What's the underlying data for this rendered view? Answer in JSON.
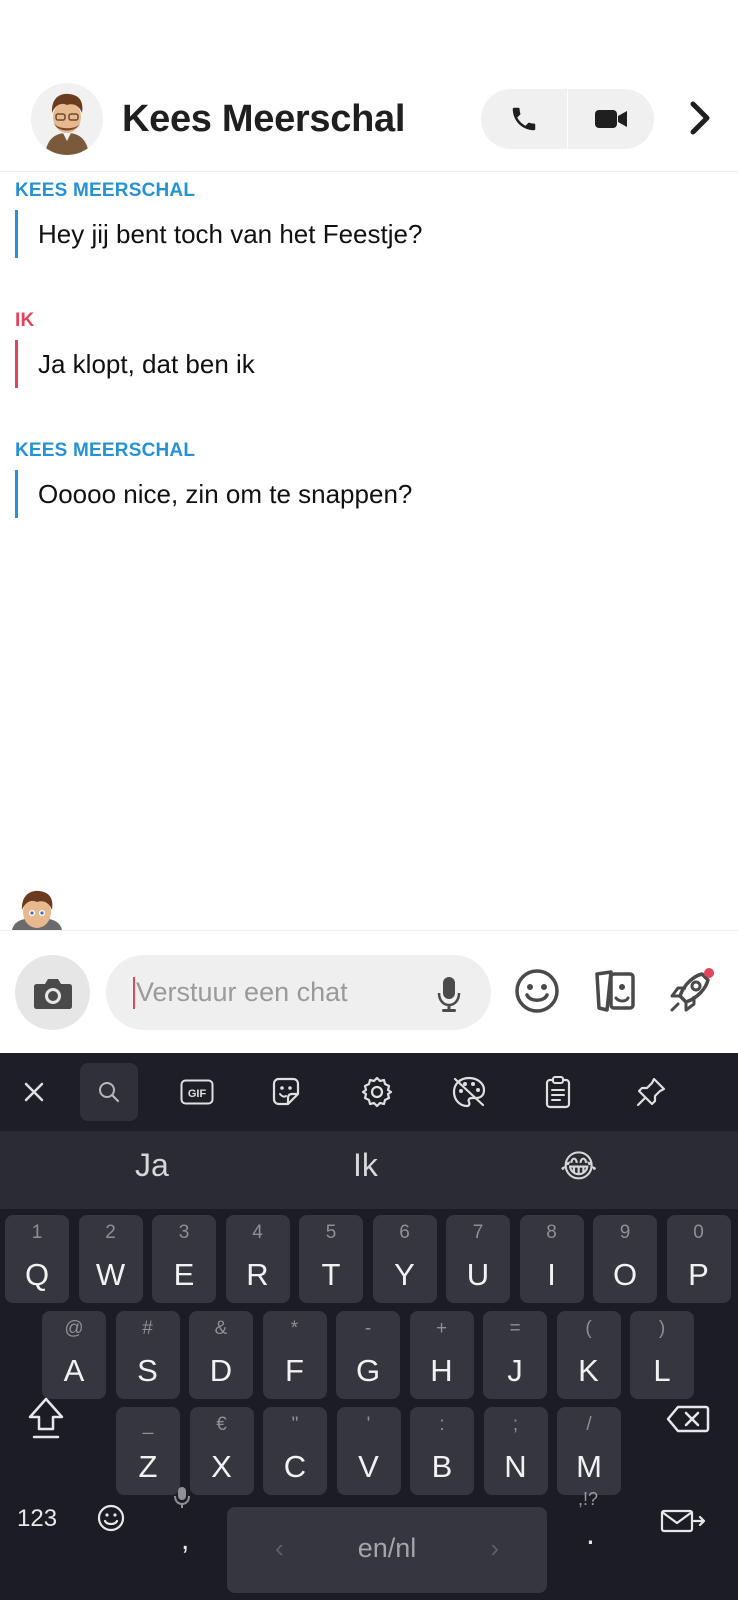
{
  "header": {
    "contact_name": "Kees Meerschal"
  },
  "messages": [
    {
      "sender": "KEES MEERSCHAL",
      "text": "Hey jij bent toch van het Feestje?"
    },
    {
      "sender": "IK",
      "text": "Ja klopt, dat ben ik"
    },
    {
      "sender": "KEES MEERSCHAL",
      "text": "Ooooo nice, zin om te snappen?"
    }
  ],
  "composer": {
    "placeholder": "Verstuur een chat"
  },
  "colors": {
    "contact": "#2592d4",
    "me": "#e2445c",
    "notification_dot": "#e2445c",
    "keyboard_bg": "#1c1c24",
    "key_bg": "#35363e"
  },
  "keyboard": {
    "toolbar": [
      "close-icon",
      "search-icon",
      "gif-icon",
      "sticker-icon",
      "settings-icon",
      "palette-icon",
      "clipboard-icon",
      "pin-icon"
    ],
    "gif_label": "GIF",
    "suggestions": [
      "Ja",
      "Ik",
      "😂"
    ],
    "row1": [
      {
        "main": "Q",
        "sub": "1"
      },
      {
        "main": "W",
        "sub": "2"
      },
      {
        "main": "E",
        "sub": "3"
      },
      {
        "main": "R",
        "sub": "4"
      },
      {
        "main": "T",
        "sub": "5"
      },
      {
        "main": "Y",
        "sub": "6"
      },
      {
        "main": "U",
        "sub": "7"
      },
      {
        "main": "I",
        "sub": "8"
      },
      {
        "main": "O",
        "sub": "9"
      },
      {
        "main": "P",
        "sub": "0"
      }
    ],
    "row2": [
      {
        "main": "A",
        "sub": "@"
      },
      {
        "main": "S",
        "sub": "#"
      },
      {
        "main": "D",
        "sub": "&"
      },
      {
        "main": "F",
        "sub": "*"
      },
      {
        "main": "G",
        "sub": "-"
      },
      {
        "main": "H",
        "sub": "+"
      },
      {
        "main": "J",
        "sub": "="
      },
      {
        "main": "K",
        "sub": "("
      },
      {
        "main": "L",
        "sub": ")"
      }
    ],
    "row3": [
      {
        "main": "Z",
        "sub": "_"
      },
      {
        "main": "X",
        "sub": "€"
      },
      {
        "main": "C",
        "sub": "\""
      },
      {
        "main": "V",
        "sub": "'"
      },
      {
        "main": "B",
        "sub": ":"
      },
      {
        "main": "N",
        "sub": ";"
      },
      {
        "main": "M",
        "sub": "/"
      }
    ],
    "numbers_label": "123",
    "comma_label": ",",
    "space_label": "en/nl",
    "space_left": "‹",
    "space_right": "›",
    "period_label": ".",
    "punct_label": ",!?"
  }
}
